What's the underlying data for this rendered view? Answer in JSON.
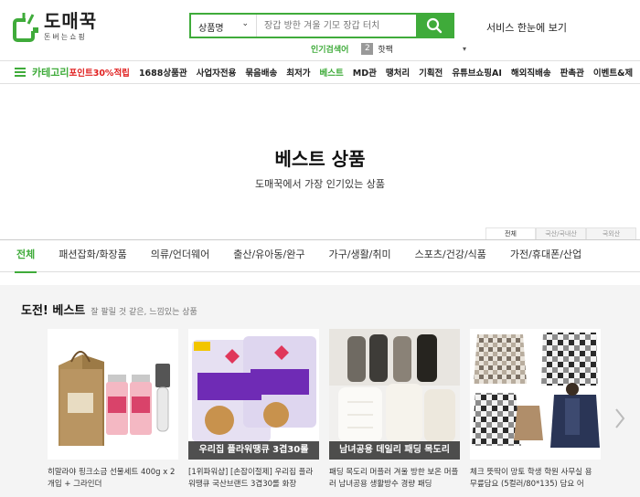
{
  "header": {
    "logo_title": "도매꾹",
    "logo_sub": "돈버는쇼핑",
    "search_category": "상품명",
    "search_placeholder": "장갑 방한 겨울 기모 장갑 터치",
    "rank_label": "인기검색어",
    "rank_number": "2",
    "rank_word": "핫팩",
    "service_link": "서비스 한눈에 보기"
  },
  "nav": {
    "category_label": "카테고리",
    "items": [
      {
        "label": "포인트30%적립",
        "style": "red"
      },
      {
        "label": "1688상품관",
        "style": "normal"
      },
      {
        "label": "사업자전용",
        "style": "normal"
      },
      {
        "label": "묶음배송",
        "style": "normal"
      },
      {
        "label": "최저가",
        "style": "normal"
      },
      {
        "label": "베스트",
        "style": "green"
      },
      {
        "label": "MD관",
        "style": "normal"
      },
      {
        "label": "땡처리",
        "style": "normal"
      },
      {
        "label": "기획전",
        "style": "normal"
      },
      {
        "label": "유튜브쇼핑AI",
        "style": "normal"
      },
      {
        "label": "해외직배송",
        "style": "normal"
      },
      {
        "label": "판촉관",
        "style": "normal"
      },
      {
        "label": "이벤트&제",
        "style": "normal"
      }
    ]
  },
  "page": {
    "title": "베스트 상품",
    "description": "도매꾹에서 가장 인기있는 상품"
  },
  "region_tabs": [
    "전체",
    "국산/국내산",
    "국외산"
  ],
  "category_tabs": [
    "전체",
    "패션잡화/화장품",
    "의류/언더웨어",
    "출산/유아동/완구",
    "가구/생활/취미",
    "스포츠/건강/식품",
    "가전/휴대폰/산업"
  ],
  "section": {
    "title": "도전! 베스트",
    "subtitle": "잘 팔릴 것 같은, 느낌있는 상품"
  },
  "products": [
    {
      "name": "히말라야 핑크소금 선물세트 400g x 2개입 + 그라인더",
      "caption": "",
      "image": "salt-gift-set"
    },
    {
      "name": "[1위파워샵] [손잡이절제] 우리집 플라워땡큐 국산브랜드 3겹30롤 화장",
      "caption": "우리집 플라워땡큐 3겹30롤",
      "image": "toilet-paper"
    },
    {
      "name": "패딩 목도리 머플러 겨울 방한 보온 머플러 남녀공용 생활방수 경량 패딩",
      "caption": "남녀공용 데일리 패딩 목도리",
      "image": "padding-scarf"
    },
    {
      "name": "체크 뜻딱이 망토 학생 학원 사무실 용 무릎담요 (5컬러/80*135) 담요 어",
      "caption": "",
      "image": "check-cape-blanket"
    }
  ],
  "colors": {
    "accent": "#3fab3a",
    "highlight_red": "#e02020"
  }
}
